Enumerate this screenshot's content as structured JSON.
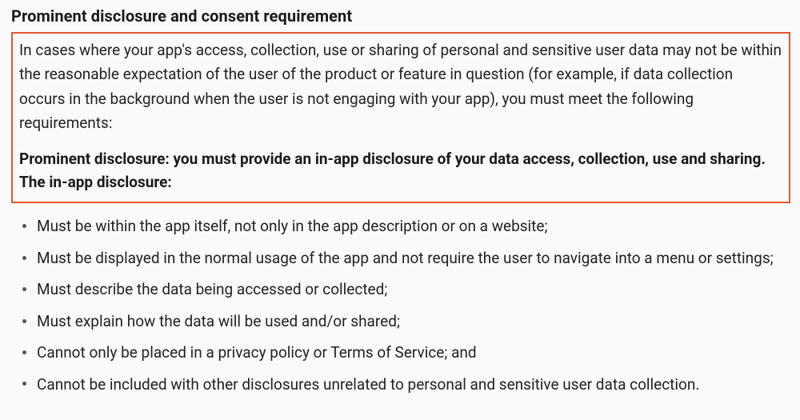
{
  "heading": "Prominent disclosure and consent requirement",
  "box": {
    "intro": "In cases where your app's access, collection, use or sharing of personal and sensitive user data may not be within the reasonable expectation of the user of the product or feature in question (for example, if data collection occurs in the background when the user is not engaging with your app), you must meet the following requirements:",
    "emphasis": "Prominent disclosure: you must provide an in-app disclosure of your data access, collection, use and sharing. The in-app disclosure:"
  },
  "bullets": [
    "Must be within the app itself, not only in the app description or on a website;",
    "Must be displayed in the normal usage of the app and not require the user to navigate into a menu or settings;",
    "Must describe the data being accessed or collected;",
    "Must explain how the data will be used and/or shared;",
    "Cannot only be placed in a privacy policy or Terms of Service; and",
    "Cannot be included with other disclosures unrelated to personal and sensitive user data collection."
  ]
}
